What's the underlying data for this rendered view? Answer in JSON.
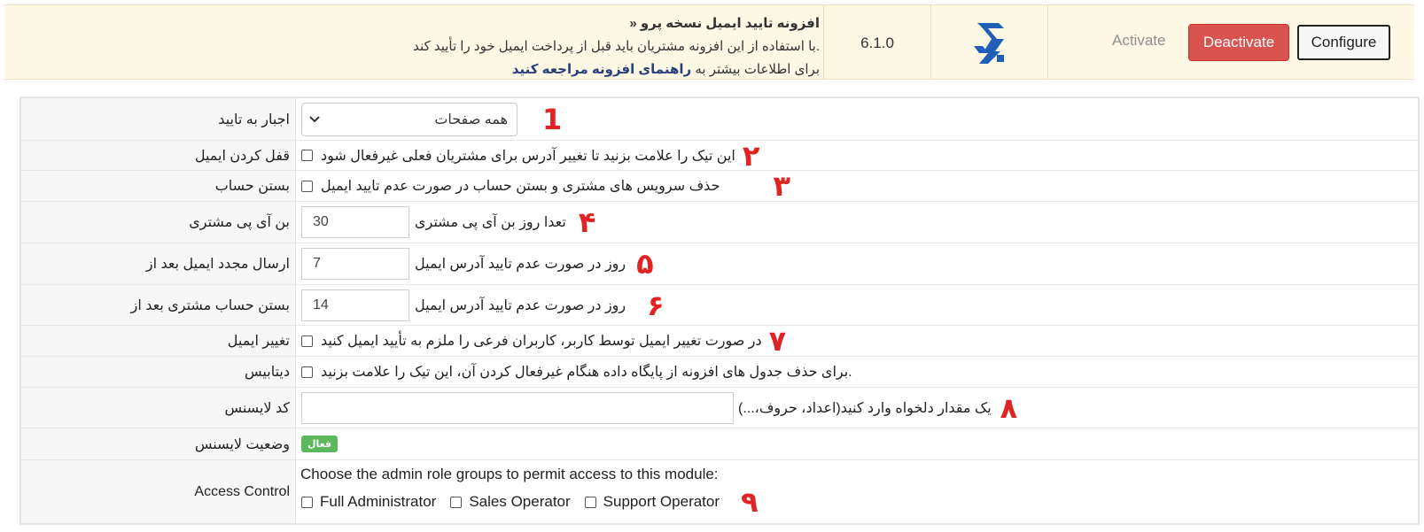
{
  "module": {
    "title": "افزونه تایید ایمیل نسخه پرو «",
    "description_line1": ".با استفاده از این افزونه مشتریان باید قبل از پرداخت ایمیل خود را تأیید کند",
    "description_line2_prefix": "برای اطلاعات بیشتر به",
    "description_line2_link": "راهنمای افزونه مراجعه کنید",
    "version": "6.1.0",
    "logo_icon": "module-logo-icon",
    "activate_label": "Activate",
    "deactivate_label": "Deactivate",
    "configure_label": "Configure",
    "colors": {
      "row_bg": "#fcf8e3",
      "deactivate": "#d9534f",
      "logo": "#1f5fb8"
    }
  },
  "settings": {
    "force_verify": {
      "label": "اجبار به تایید",
      "value": "همه صفحات",
      "marker": "1"
    },
    "lock_email": {
      "label": "قفل کردن ایمیل",
      "description": "این تیک را علامت بزنید تا تغییر آدرس برای مشتریان فعلی غیرفعال شود",
      "checked": false,
      "marker": "۲"
    },
    "close_account": {
      "label": "بستن حساب",
      "description": "حذف سرویس های مشتری و بستن حساب در صورت عدم تایید ایمیل",
      "checked": false,
      "marker": "۳"
    },
    "ban_ip": {
      "label": "بن آی پی مشتری",
      "value": "30",
      "suffix": "تعدا روز بن آی پی مشتری",
      "marker": "۴"
    },
    "resend_email": {
      "label": "ارسال مجدد ایمیل بعد از",
      "value": "7",
      "suffix": "روز در صورت عدم تایید آدرس ایمیل",
      "marker": "۵"
    },
    "close_after": {
      "label": "بستن حساب مشتری بعد از",
      "value": "14",
      "suffix": "روز در صورت عدم تایید آدرس ایمیل",
      "marker": "۶"
    },
    "change_email": {
      "label": "تغییر ایمیل",
      "description": "در صورت تغییر ایمیل توسط کاربر، کاربران فرعی را ملزم به تأیید ایمیل کنید",
      "checked": false,
      "marker": "۷"
    },
    "database": {
      "label": "دیتابیس",
      "description": ".برای حذف جدول های افزونه از پایگاه داده هنگام غیرفعال کردن آن، این تیک را علامت بزنید",
      "checked": false
    },
    "license_code": {
      "label": "کد لایسنس",
      "value": "",
      "hint": "یک مقدار دلخواه وارد کنید(اعداد، حروف،...)",
      "marker": "۸"
    },
    "license_status": {
      "label": "وضعیت لایسنس",
      "badge": "فعال",
      "badge_color": "#5cb85c"
    },
    "access_control": {
      "label": "Access Control",
      "heading": "Choose the admin role groups to permit access to this module:",
      "options": [
        "Full Administrator",
        "Sales Operator",
        "Support Operator"
      ],
      "marker": "۹"
    }
  },
  "marker_color": "#e02424"
}
